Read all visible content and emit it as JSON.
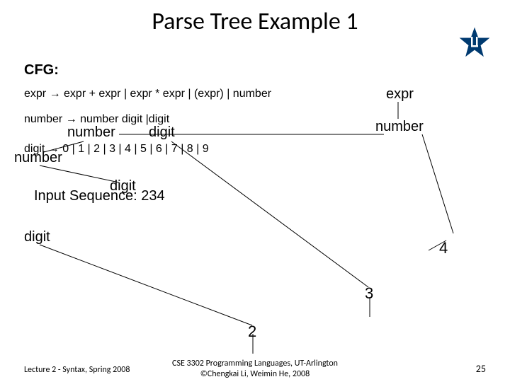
{
  "title": "Parse Tree Example 1",
  "cfg_label": "CFG:",
  "rules": {
    "r1": "expr → expr + expr | expr * expr | (expr) | number",
    "r2": "number → number digit |digit",
    "r3": "digit → 0 | 1 | 2 | 3 | 4 | 5 | 6 | 7 | 8 | 9"
  },
  "input_label": "Input Sequence: 234",
  "tree": {
    "expr": "expr",
    "number1": "number",
    "number2": "number",
    "digit1": "digit",
    "number3": "number",
    "digit2": "digit",
    "digit3": "digit",
    "leaf4": "4",
    "leaf3": "3",
    "leaf2": "2"
  },
  "footer": {
    "left": "Lecture 2 - Syntax, Spring 2008",
    "center1": "CSE 3302 Programming Languages, UT-Arlington",
    "center2": "©Chengkai Li, Weimin He, 2008",
    "page": "25"
  }
}
